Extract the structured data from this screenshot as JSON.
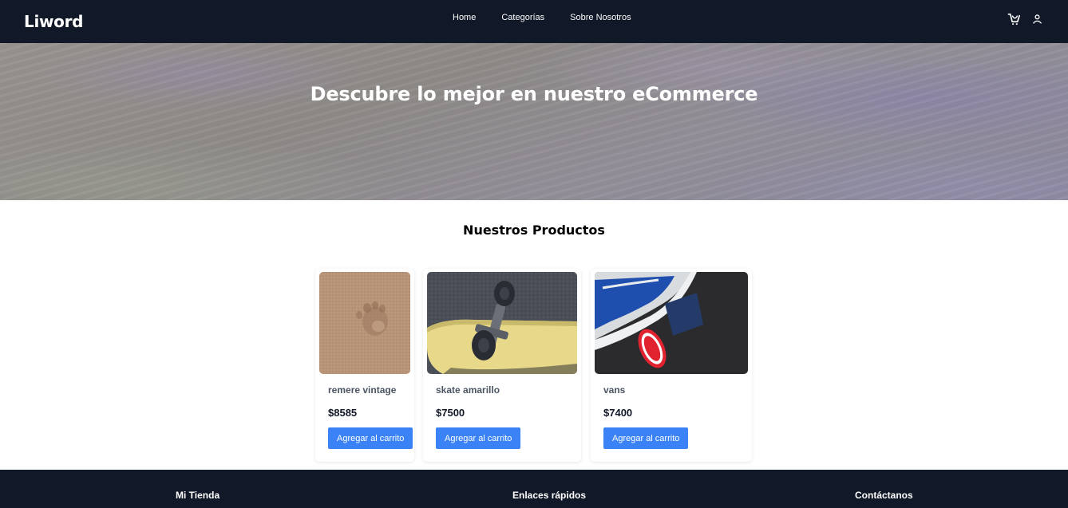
{
  "brand": "Liword",
  "nav": {
    "links": [
      "Home",
      "Categorías",
      "Sobre Nosotros"
    ]
  },
  "icons": [
    "cart-icon",
    "user-icon"
  ],
  "hero": {
    "title": "Descubre lo mejor en nuestro eCommerce"
  },
  "products_section": {
    "title": "Nuestros Productos"
  },
  "products": [
    {
      "name": "remere vintage",
      "price": "$8585",
      "button": "Agregar al carrito"
    },
    {
      "name": "skate amarillo",
      "price": "$7500",
      "button": "Agregar al carrito"
    },
    {
      "name": "vans",
      "price": "$7400",
      "button": "Agregar al carrito"
    }
  ],
  "footer": {
    "columns": [
      "Mi Tienda",
      "Enlaces rápidos",
      "Contáctanos"
    ]
  },
  "colors": {
    "nav_bg": "#111827",
    "button_bg": "#3b82f6",
    "footer_bg": "#111827"
  }
}
